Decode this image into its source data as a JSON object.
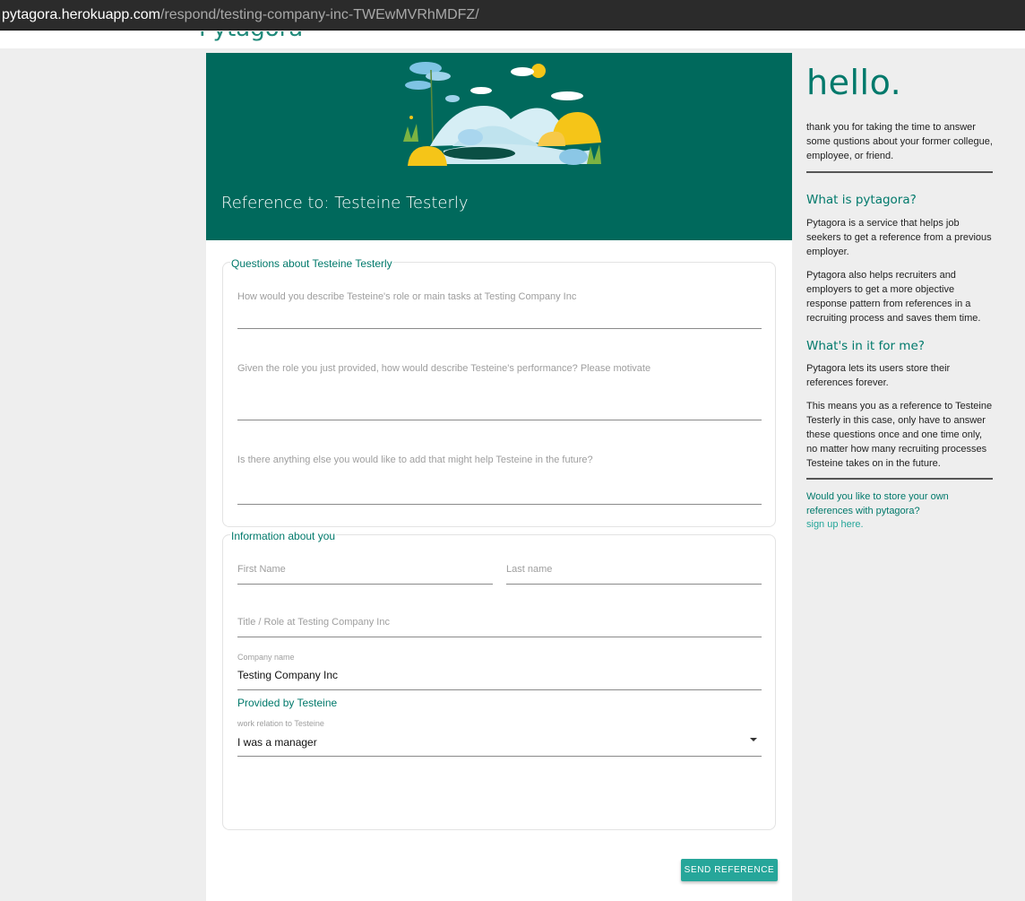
{
  "browser": {
    "url_host": "pytagora.herokuapp.com",
    "url_path": "/respond/testing-company-inc-TWEwMVRhMDFZ/"
  },
  "header": {
    "brand": "Pytagora"
  },
  "hero": {
    "title": "Reference to: Testeine Testerly"
  },
  "questions": {
    "legend": "Questions about Testeine Testerly",
    "q1_placeholder": "How would you describe Testeine's role or main tasks at Testing Company Inc",
    "q2_placeholder": "Given the role you just provided, how would describe Testeine's performance? Please motivate",
    "q3_placeholder": "Is there anything else you would like to add that might help Testeine in the future?"
  },
  "info": {
    "legend": "Information about you",
    "first_name_placeholder": "First Name",
    "last_name_placeholder": "Last name",
    "title_placeholder": "Title / Role at Testing Company Inc",
    "company_label": "Company name",
    "company_value": "Testing Company Inc",
    "provided_by": "Provided by Testeine",
    "relation_label": "work relation to Testeine",
    "relation_value": "I was a manager"
  },
  "actions": {
    "send_label": "SEND REFERENCE"
  },
  "sidebar": {
    "hello": "hello.",
    "intro": "thank you for taking the time to answer some qustions about your former collegue, employee, or friend.",
    "what_heading": "What is pytagora?",
    "what_p1": "Pytagora is a service that helps job seekers to get a reference from a previous employer.",
    "what_p2": "Pytagora also helps recruiters and employers to get a more objective response pattern from references in a recruiting process and saves them time.",
    "benefit_heading": "What's in it for me?",
    "benefit_p1": "Pytagora lets its users store their references forever.",
    "benefit_p2": "This means you as a reference to Testeine Testerly in this case, only have to answer these questions once and one time only, no matter how many recruiting processes Testeine takes on in the future.",
    "cta": "Would you like to store your own references with pytagora?",
    "signup": "sign up here."
  },
  "colors": {
    "primary_dark": "#00695c",
    "accent": "#26a69a",
    "text_accent": "#00796b"
  },
  "icons": {
    "dropdown": "caret-down-icon"
  }
}
